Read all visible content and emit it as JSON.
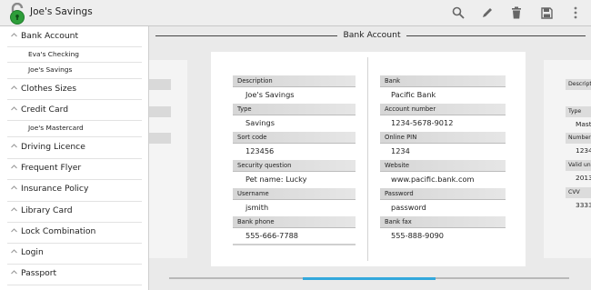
{
  "app": {
    "title": "Joe's Savings",
    "icon": "lock-open-icon",
    "accent": "#33a8dc",
    "icon_color": "#2e9e3a"
  },
  "actions": [
    {
      "name": "search-icon"
    },
    {
      "name": "edit-icon"
    },
    {
      "name": "delete-icon"
    },
    {
      "name": "save-icon"
    },
    {
      "name": "overflow-menu-icon"
    }
  ],
  "sidebar": {
    "categories": [
      {
        "label": "Bank Account",
        "items": [
          "Eva's Checking",
          "Joe's Savings"
        ]
      },
      {
        "label": "Clothes Sizes",
        "items": []
      },
      {
        "label": "Credit Card",
        "items": [
          "Joe's Mastercard"
        ]
      },
      {
        "label": "Driving Licence",
        "items": []
      },
      {
        "label": "Frequent Flyer",
        "items": []
      },
      {
        "label": "Insurance Policy",
        "items": []
      },
      {
        "label": "Library Card",
        "items": []
      },
      {
        "label": "Lock Combination",
        "items": []
      },
      {
        "label": "Login",
        "items": []
      },
      {
        "label": "Passport",
        "items": []
      }
    ]
  },
  "section": {
    "title": "Bank Account"
  },
  "card": {
    "left": [
      {
        "label": "Description",
        "value": "Joe's Savings"
      },
      {
        "label": "Type",
        "value": "Savings"
      },
      {
        "label": "Sort code",
        "value": "123456"
      },
      {
        "label": "Security question",
        "value": "Pet name: Lucky"
      },
      {
        "label": "Username",
        "value": "jsmith"
      },
      {
        "label": "Bank phone",
        "value": "555-666-7788"
      }
    ],
    "right": [
      {
        "label": "Bank",
        "value": "Pacific Bank"
      },
      {
        "label": "Account number",
        "value": "1234-5678-9012"
      },
      {
        "label": "Online PIN",
        "value": "1234"
      },
      {
        "label": "Website",
        "value": "www.pacific.bank.com"
      },
      {
        "label": "Password",
        "value": "password"
      },
      {
        "label": "Bank fax",
        "value": "555-888-9090"
      }
    ]
  },
  "next_card": {
    "fields": [
      {
        "label": "Description",
        "value": ""
      },
      {
        "label": "Type",
        "value": "Mast"
      },
      {
        "label": "Number",
        "value": "1234"
      },
      {
        "label": "Valid un",
        "value": "2013"
      },
      {
        "label": "CVV",
        "value": "3333"
      }
    ]
  }
}
